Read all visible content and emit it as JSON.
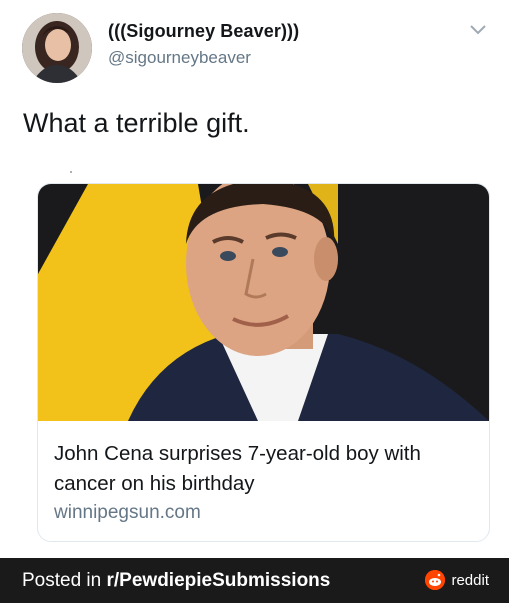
{
  "tweet": {
    "display_name": "(((Sigourney Beaver)))",
    "handle": "@sigourneybeaver",
    "text": "What a terrible gift."
  },
  "link_card": {
    "title": "John Cena surprises 7-year-old boy with cancer on his birthday",
    "domain": "winnipegsun.com"
  },
  "footer": {
    "posted_prefix": "Posted in ",
    "subreddit": "r/PewdiepieSubmissions",
    "brand": "reddit"
  },
  "colors": {
    "footer_bg": "#1a1a1b",
    "reddit_orange": "#ff4500",
    "handle_gray": "#657786"
  },
  "icons": [
    "avatar-photo",
    "chevron-down-icon",
    "reddit-logo-icon"
  ]
}
